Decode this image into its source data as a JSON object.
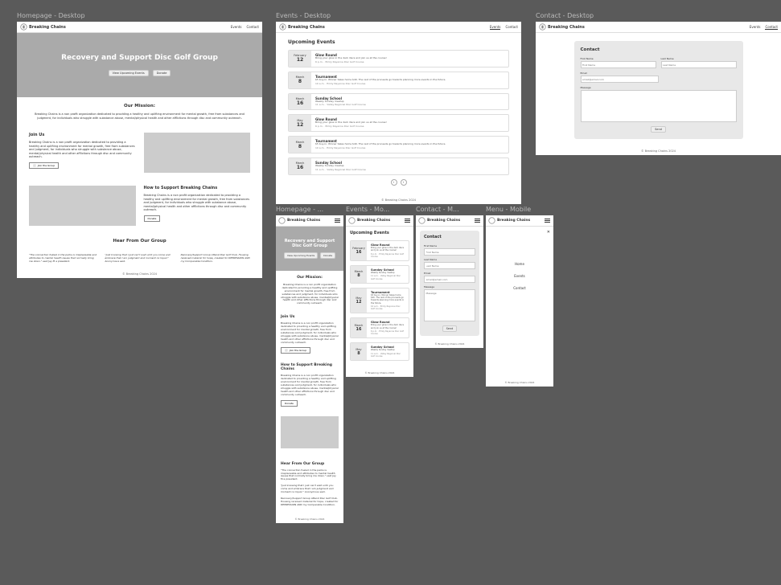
{
  "brand": "Breaking Chains",
  "nav": {
    "events": "Events",
    "contact": "Contact",
    "home": "Home"
  },
  "hero": {
    "title": "Recovery and Support Disc Golf Group",
    "btn_events": "View Upcoming Events",
    "btn_donate": "Donate"
  },
  "mission": {
    "heading": "Our Mission:",
    "text": "Breaking Chains is a non profit organization dedicated to providing a healthy and uplifting environment for mental growth, free from substances and judgment, for individuals who struggle with substance abuse, mental/physical health and other afflictions through disc and community outreach."
  },
  "join": {
    "heading": "Join Us",
    "text": "Breaking Chains is a non profit organization dedicated to providing a healthy and uplifting environment for mental growth, free from substances and judgment, for individuals who struggle with substance abuse, mental/physical health and other afflictions through disc and community outreach.",
    "btn": "Join the Group"
  },
  "support": {
    "heading": "How to Support Breaking Chains",
    "text": "Breaking Chains is a non profit organization dedicated to providing a healthy and uplifting environment for mental growth, free from substances and judgment, for individuals who struggle with substance abuse, mental/physical health and other afflictions through disc and community outreach.",
    "btn": "Donate"
  },
  "hear": {
    "heading": "Hear From Our Group",
    "t1": "\"The connection fueled in the parks is irreplaceable and attributes to mental health issues that normally bring me down.\" said Jay M a president.",
    "t2": "\"Just knowing that I just can't wait until you come and embrace that I am judgment and moment no liquor.\" Anonymous said.",
    "t3": "Recovery/Support Group Attend Disc Golf Club. Housing received material for hope, created for DEPRESSION AND my Comparable Condition."
  },
  "footer": "© Breaking Chains 2024",
  "events": {
    "heading": "Upcoming Events",
    "list": [
      {
        "month": "February",
        "day": "12",
        "title": "Glow Round",
        "desc": "Bring your glow in the dark discs and join us at the course!",
        "meta": "6 p.m. · Emily Rayanne Disc Golf Course"
      },
      {
        "month": "March",
        "day": "8",
        "title": "Tournament",
        "desc": "$5 buy-in. Winner takes home $40. The rest of the proceeds go towards planning more events in the future.",
        "meta": "10 a.m. · Emily Rayanne Disc Golf Course"
      },
      {
        "month": "March",
        "day": "16",
        "title": "Sunday School",
        "desc": "Weekly Sunday meetup",
        "meta": "11 a.m. · Valley Regional Disc Golf Course"
      },
      {
        "month": "May",
        "day": "12",
        "title": "Glow Round",
        "desc": "Bring your glow in the dark discs and join us at the course!",
        "meta": "6 p.m. · Emily Rayanne Disc Golf Course"
      },
      {
        "month": "March",
        "day": "8",
        "title": "Tournament",
        "desc": "$5 buy-in. Winner takes home $40. The rest of the proceeds go towards planning more events in the future.",
        "meta": "10 a.m. · Emily Rayanne Disc Golf Course"
      },
      {
        "month": "March",
        "day": "16",
        "title": "Sunday School",
        "desc": "Weekly Sunday meetup",
        "meta": "11 a.m. · Valley Regional Disc Golf Course"
      }
    ]
  },
  "events_m": {
    "list": [
      {
        "month": "February",
        "day": "16",
        "title": "Glow Round",
        "desc": "Bring your glow in the dark discs and join us at the course!",
        "meta": "6 p.m. · Emily Rayanne Disc Golf Course"
      },
      {
        "month": "March",
        "day": "8",
        "title": "Sunday School",
        "desc": "Weekly Sunday meetup",
        "meta": "11 a.m. · Valley Regional Disc Golf Course"
      },
      {
        "month": "May",
        "day": "12",
        "title": "Tournament",
        "desc": "$5 buy-in. Winner takes home $40. The rest of the proceeds go towards planning more events in the future.",
        "meta": "10 a.m. · Emily Rayanne Disc Golf Course"
      },
      {
        "month": "March",
        "day": "16",
        "title": "Glow Round",
        "desc": "Bring your glow in the dark discs and join us at the course!",
        "meta": "6 p.m. · Emily Rayanne Disc Golf Course"
      },
      {
        "month": "May",
        "day": "8",
        "title": "Sunday School",
        "desc": "Weekly Sunday meetup",
        "meta": "11 a.m. · Valley Regional Disc Golf Course"
      }
    ]
  },
  "contact": {
    "heading": "Contact",
    "first": "First Name",
    "first_ph": "First Name",
    "last": "Last Name",
    "last_ph": "Last Name",
    "email": "Email",
    "email_ph": "email@email.com",
    "message": "Message",
    "msg_ph": "Message",
    "send": "Send"
  },
  "labels": {
    "home_d": "Homepage - Desktop",
    "events_d": "Events - Desktop",
    "contact_d": "Contact - Desktop",
    "home_m": "Homepage - ...",
    "events_m": "Events - Mo...",
    "contact_m": "Contact - M...",
    "menu_m": "Menu - Mobile"
  }
}
